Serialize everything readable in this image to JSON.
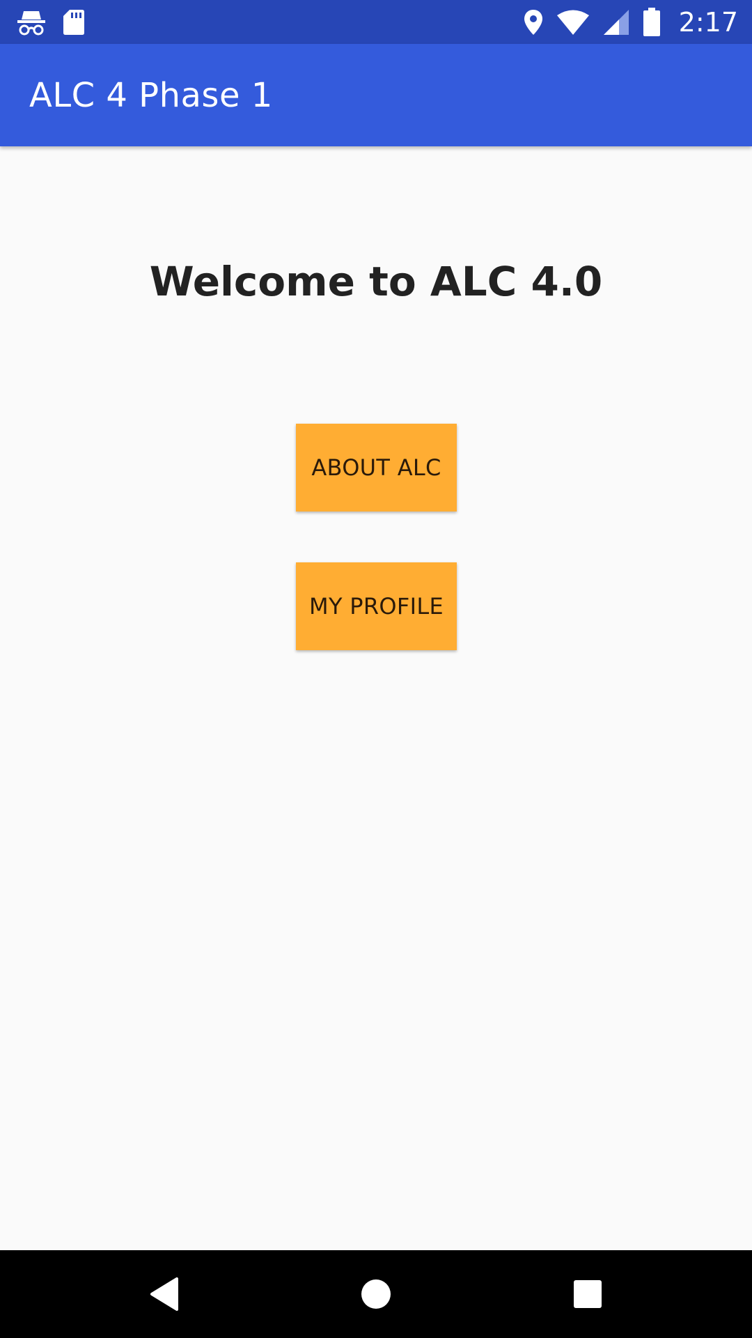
{
  "status_bar": {
    "time": "2:17",
    "left_icons": [
      "incognito-icon",
      "sd-card-icon"
    ],
    "right_icons": [
      "location-icon",
      "wifi-icon",
      "signal-icon",
      "battery-icon"
    ]
  },
  "app_bar": {
    "title": "ALC 4 Phase 1"
  },
  "content": {
    "welcome": "Welcome to ALC 4.0",
    "buttons": {
      "about": "ABOUT ALC",
      "profile": "MY PROFILE"
    }
  },
  "nav_bar": {
    "icons": [
      "back-icon",
      "home-icon",
      "recents-icon"
    ]
  },
  "colors": {
    "status_bar": "#2746b6",
    "app_bar": "#345bdc",
    "button": "#ffad33",
    "background": "#fafafa",
    "nav_bar": "#000000"
  }
}
